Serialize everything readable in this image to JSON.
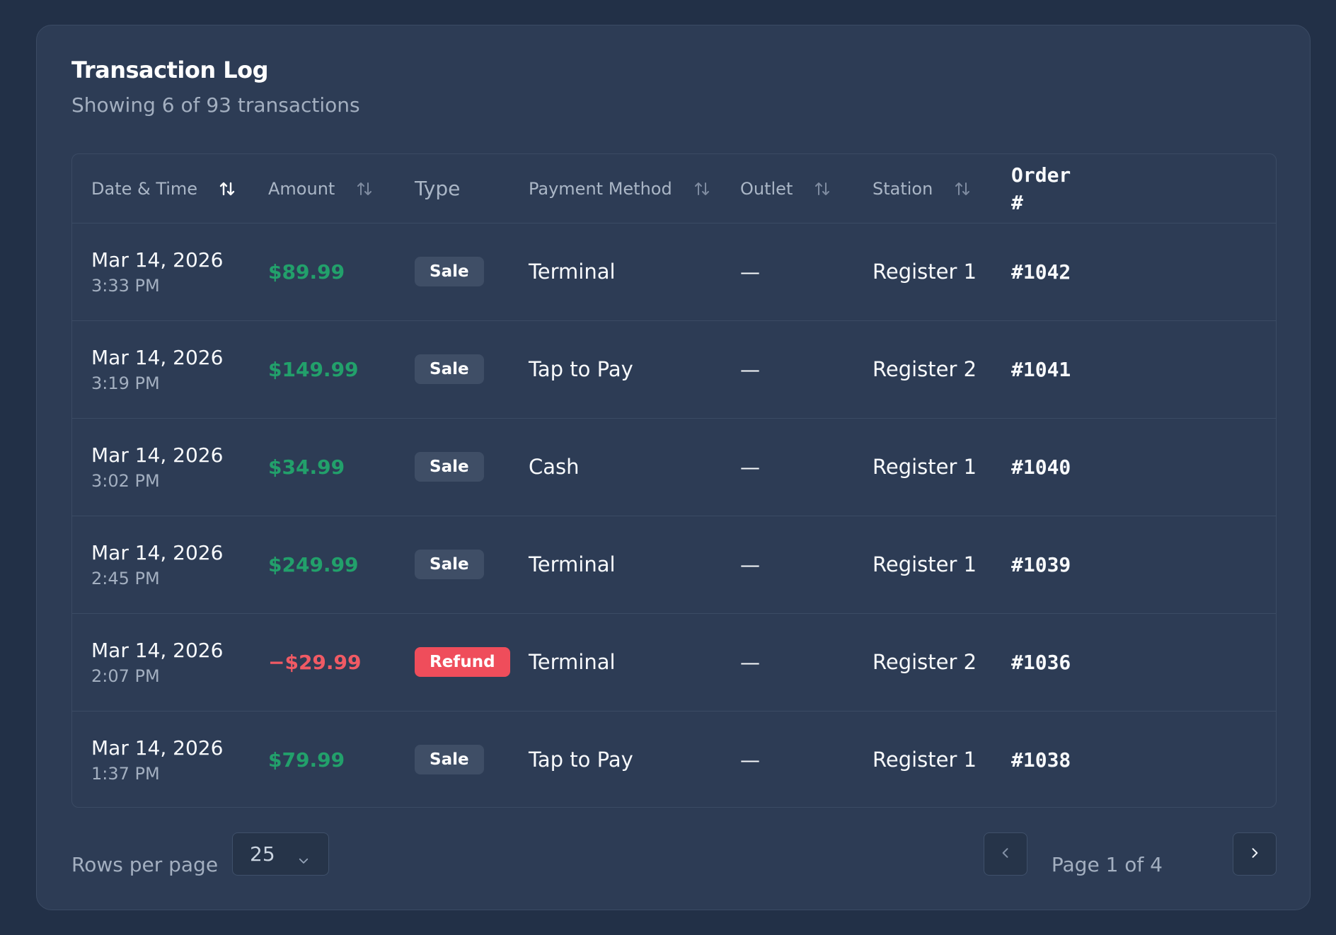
{
  "header": {
    "title": "Transaction Log",
    "subtitle": "Showing 6 of 93 transactions"
  },
  "columns": {
    "date": "Date & Time",
    "amount": "Amount",
    "type": "Type",
    "method": "Payment Method",
    "outlet": "Outlet",
    "station": "Station",
    "order": "Order #"
  },
  "colors": {
    "positive": "#22a06b",
    "negative": "#f05a64",
    "sale_badge": "#3f4e66",
    "refund_badge": "#ef4d5b"
  },
  "rows": [
    {
      "date": "Mar 14, 2026",
      "time": "3:33 PM",
      "amount": "$89.99",
      "amount_kind": "positive",
      "type": "Sale",
      "type_kind": "sale",
      "method": "Terminal",
      "outlet": "—",
      "station": "Register 1",
      "order": "#1042"
    },
    {
      "date": "Mar 14, 2026",
      "time": "3:19 PM",
      "amount": "$149.99",
      "amount_kind": "positive",
      "type": "Sale",
      "type_kind": "sale",
      "method": "Tap to Pay",
      "outlet": "—",
      "station": "Register 2",
      "order": "#1041"
    },
    {
      "date": "Mar 14, 2026",
      "time": "3:02 PM",
      "amount": "$34.99",
      "amount_kind": "positive",
      "type": "Sale",
      "type_kind": "sale",
      "method": "Cash",
      "outlet": "—",
      "station": "Register 1",
      "order": "#1040"
    },
    {
      "date": "Mar 14, 2026",
      "time": "2:45 PM",
      "amount": "$249.99",
      "amount_kind": "positive",
      "type": "Sale",
      "type_kind": "sale",
      "method": "Terminal",
      "outlet": "—",
      "station": "Register 1",
      "order": "#1039"
    },
    {
      "date": "Mar 14, 2026",
      "time": "2:07 PM",
      "amount": "−$29.99",
      "amount_kind": "negative",
      "type": "Refund",
      "type_kind": "refund",
      "method": "Terminal",
      "outlet": "—",
      "station": "Register 2",
      "order": "#1036"
    },
    {
      "date": "Mar 14, 2026",
      "time": "1:37 PM",
      "amount": "$79.99",
      "amount_kind": "positive",
      "type": "Sale",
      "type_kind": "sale",
      "method": "Tap to Pay",
      "outlet": "—",
      "station": "Register 1",
      "order": "#1038"
    }
  ],
  "footer": {
    "rows_label": "Rows per page",
    "rows_value": "25",
    "page_info": "Page 1 of 4",
    "prev_icon": "chevron-left-icon",
    "next_icon": "chevron-right-icon"
  }
}
